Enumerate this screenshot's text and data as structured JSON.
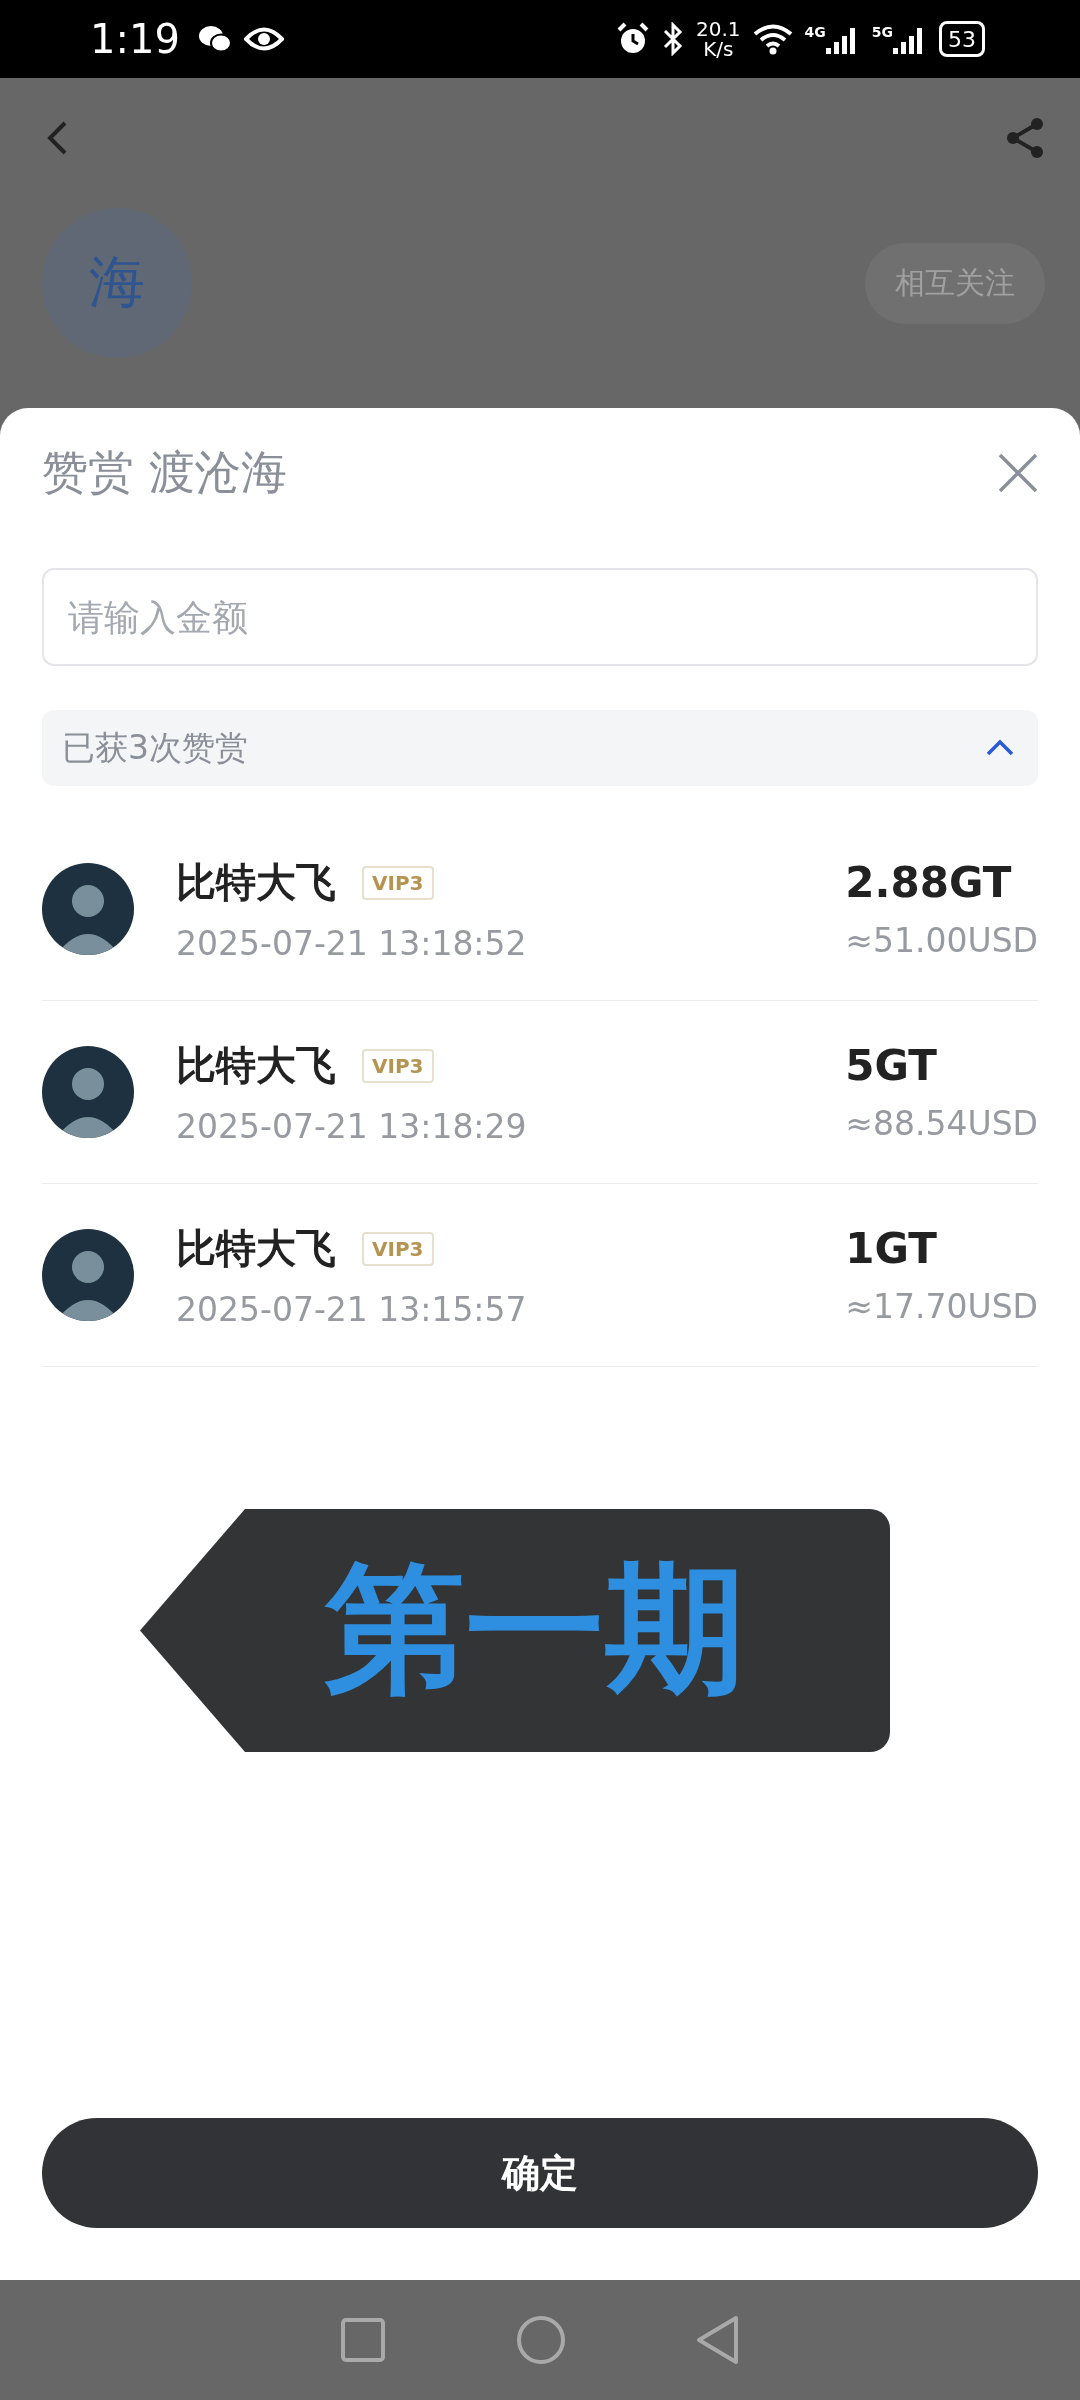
{
  "status_bar": {
    "time": "1:19",
    "net_speed_value": "20.1",
    "net_speed_unit": "K/s",
    "network_1": "4G",
    "network_2": "5G",
    "battery": "53"
  },
  "background_page": {
    "avatar_letter": "海",
    "follow_button": "相互关注"
  },
  "sheet": {
    "title": "赞赏 渡沧海",
    "amount_field": {
      "placeholder": "请输入金额"
    },
    "rewards_header": {
      "label": "已获3次赞赏",
      "expanded": true
    },
    "rewards": [
      {
        "name": "比特大飞",
        "badge": "VIP3",
        "time": "2025-07-21 13:18:52",
        "amount": "2.88GT",
        "usd": "≈51.00USD"
      },
      {
        "name": "比特大飞",
        "badge": "VIP3",
        "time": "2025-07-21 13:18:29",
        "amount": "5GT",
        "usd": "≈88.54USD"
      },
      {
        "name": "比特大飞",
        "badge": "VIP3",
        "time": "2025-07-21 13:15:57",
        "amount": "1GT",
        "usd": "≈17.70USD"
      }
    ],
    "overlay_tag": "第一期",
    "confirm_button": "确定"
  }
}
